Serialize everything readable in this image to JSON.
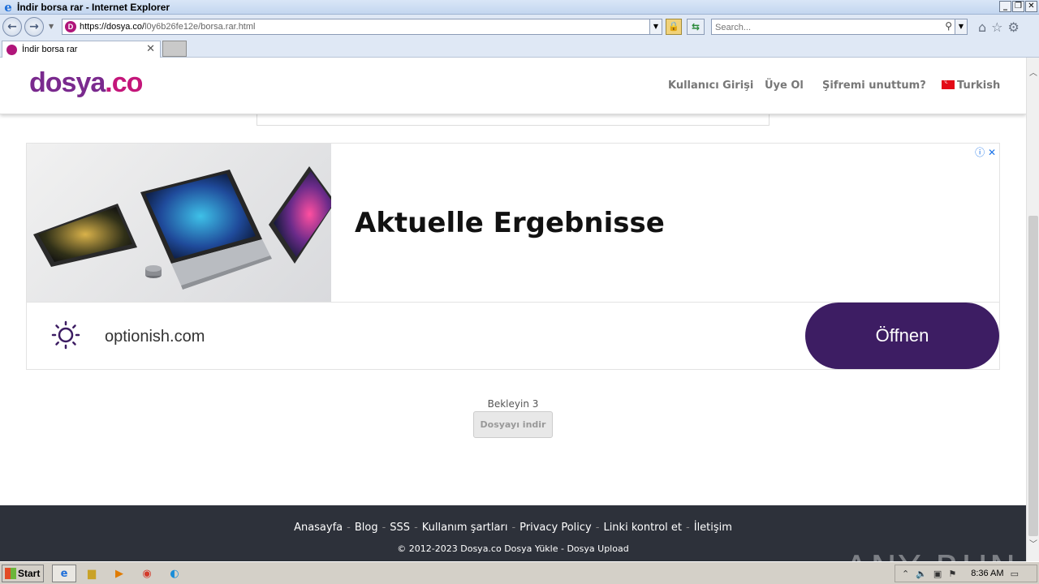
{
  "window": {
    "title": "İndir borsa rar - Internet Explorer",
    "controls": [
      "_",
      "❐",
      "✕"
    ]
  },
  "address": {
    "url_host": "https://dosya.co/",
    "url_path": "l0y6b26fe12e/borsa.rar.html"
  },
  "search": {
    "placeholder": "Search..."
  },
  "tabs": [
    {
      "label": "İndir borsa rar"
    }
  ],
  "site": {
    "logo_main": "dosya",
    "logo_suffix": ".co",
    "menu": {
      "login": "Kullanıcı Girişi",
      "signup": "Üye Ol",
      "forgot": "Şifremi unuttum?",
      "language": "Turkish"
    }
  },
  "ad": {
    "headline": "Aktuelle Ergebnisse",
    "domain": "optionish.com",
    "cta": "Öffnen",
    "icons": "ⓘ ✕",
    "brand_color": "#3d1d63"
  },
  "download": {
    "wait_text": "Bekleyin 3",
    "button_label": "Dosyayı indir"
  },
  "footer": {
    "links": [
      "Anasayfa",
      "Blog",
      "SSS",
      "Kullanım şartları",
      "Privacy Policy",
      "Linki kontrol et",
      "İletişim"
    ],
    "copyright": "© 2012-2023 Dosya.co Dosya Yükle - Dosya Upload"
  },
  "watermark": "ANY RUN",
  "taskbar": {
    "start_label": "Start",
    "clock": "8:36 AM"
  }
}
